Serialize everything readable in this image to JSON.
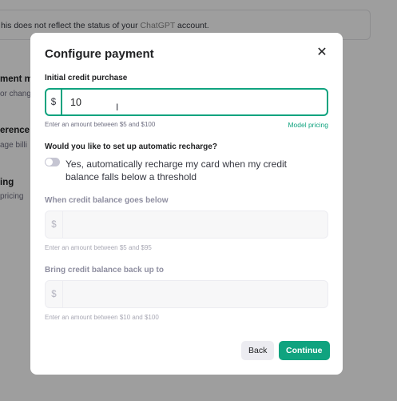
{
  "background": {
    "banner_text": "his does not reflect the status of your",
    "banner_link": "ChatGPT",
    "banner_suffix": "account.",
    "sections": [
      {
        "heading": "ment m",
        "sub": "or chang"
      },
      {
        "heading": "erence:",
        "sub": "age billi"
      },
      {
        "heading": "ing",
        "sub": "pricing"
      }
    ]
  },
  "modal": {
    "title": "Configure payment",
    "close_icon": "close-icon",
    "initial": {
      "label": "Initial credit purchase",
      "prefix": "$",
      "value": "10",
      "hint": "Enter an amount between $5 and $100",
      "link": "Model pricing"
    },
    "recharge": {
      "question": "Would you like to set up automatic recharge?",
      "toggle_label": "Yes, automatically recharge my card when my credit balance falls below a threshold",
      "toggle_on": false
    },
    "threshold": {
      "label": "When credit balance goes below",
      "prefix": "$",
      "value": "",
      "hint": "Enter an amount between $5 and $95"
    },
    "target": {
      "label": "Bring credit balance back up to",
      "prefix": "$",
      "value": "",
      "hint": "Enter an amount between $10 and $100"
    },
    "buttons": {
      "back": "Back",
      "continue": "Continue"
    }
  },
  "colors": {
    "accent": "#10a37f",
    "overlay": "rgba(0,0,0,0.38)"
  }
}
